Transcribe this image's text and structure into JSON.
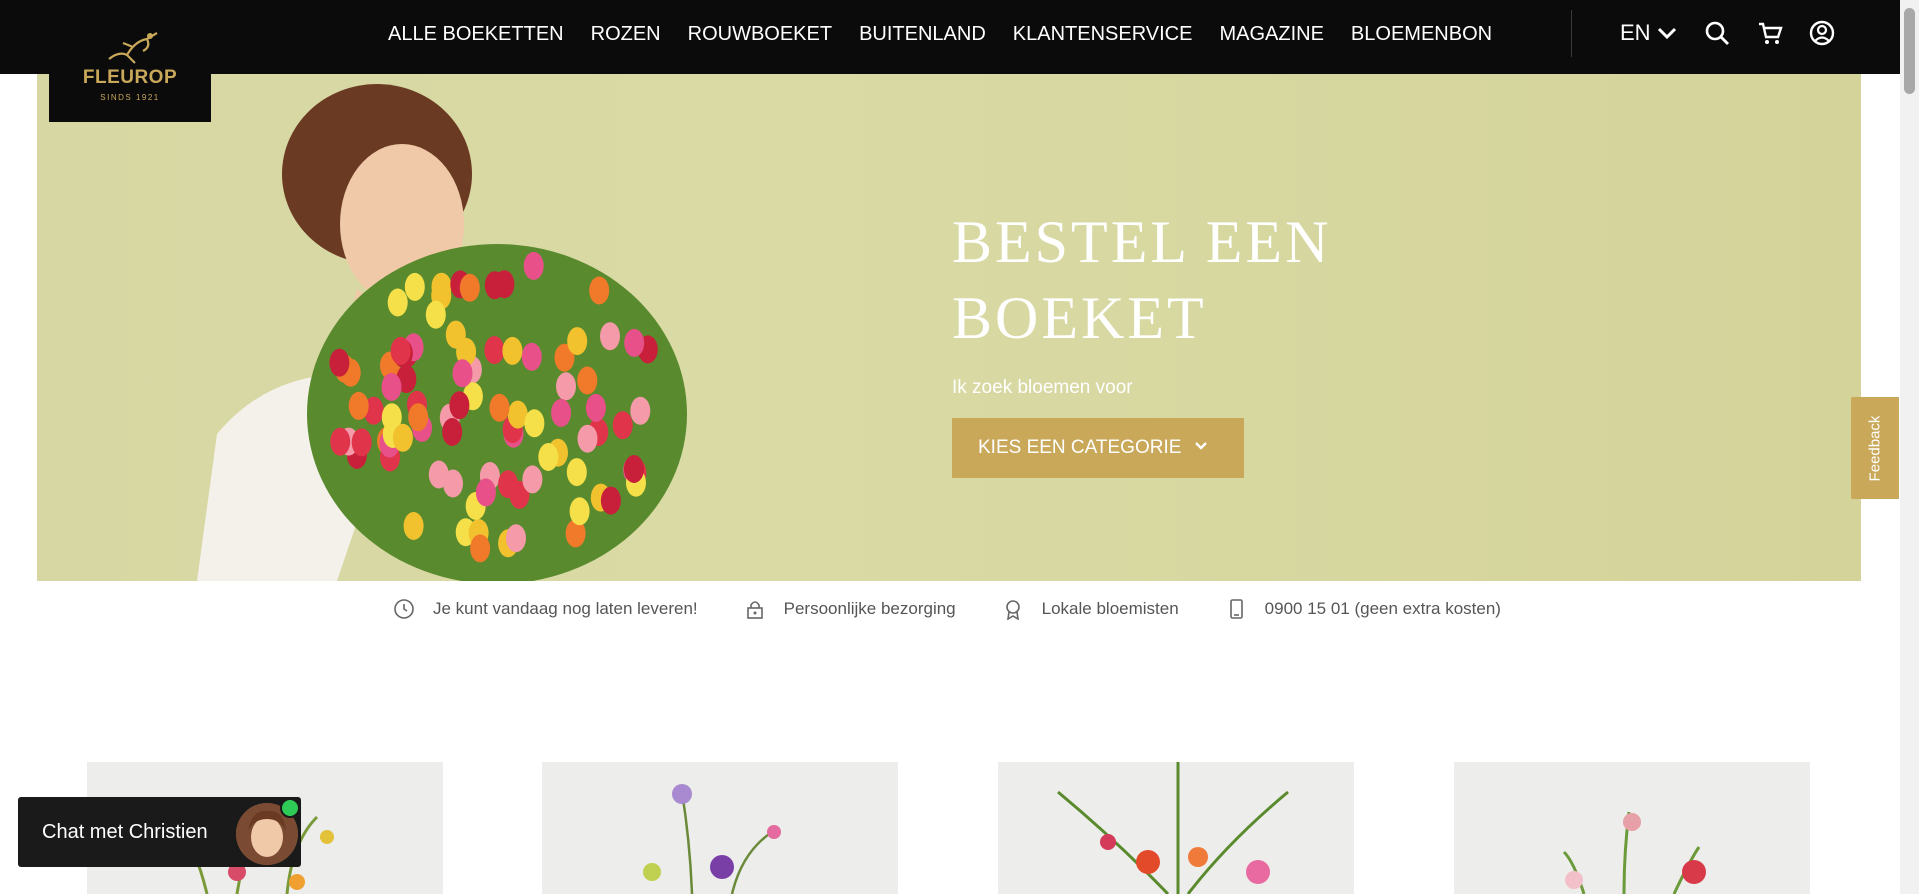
{
  "brand": {
    "name": "FLEUROP",
    "tagline": "SINDS 1921",
    "gold": "#c9a85a"
  },
  "nav": {
    "items": [
      {
        "label": "ALLE BOEKETTEN"
      },
      {
        "label": "ROZEN"
      },
      {
        "label": "ROUWBOEKET"
      },
      {
        "label": "BUITENLAND"
      },
      {
        "label": "KLANTENSERVICE"
      },
      {
        "label": "MAGAZINE"
      },
      {
        "label": "BLOEMENBON"
      }
    ],
    "language": "EN",
    "icons": [
      "chevron-down-icon",
      "search-icon",
      "cart-icon",
      "user-icon"
    ]
  },
  "hero": {
    "title_line1": "BESTEL EEN",
    "title_line2": "BOEKET",
    "subtitle": "Ik zoek bloemen voor",
    "button_label": "KIES EEN CATEGORIE"
  },
  "usps": [
    {
      "icon": "clock-icon",
      "label": "Je kunt vandaag nog laten leveren!"
    },
    {
      "icon": "lock-icon",
      "label": "Persoonlijke bezorging"
    },
    {
      "icon": "award-icon",
      "label": "Lokale bloemisten"
    },
    {
      "icon": "phone-icon",
      "label": "0900 15 01 (geen extra kosten)"
    }
  ],
  "feedback": {
    "label": "Feedback"
  },
  "chat": {
    "label": "Chat met Christien",
    "status_color": "#2ecc57"
  }
}
